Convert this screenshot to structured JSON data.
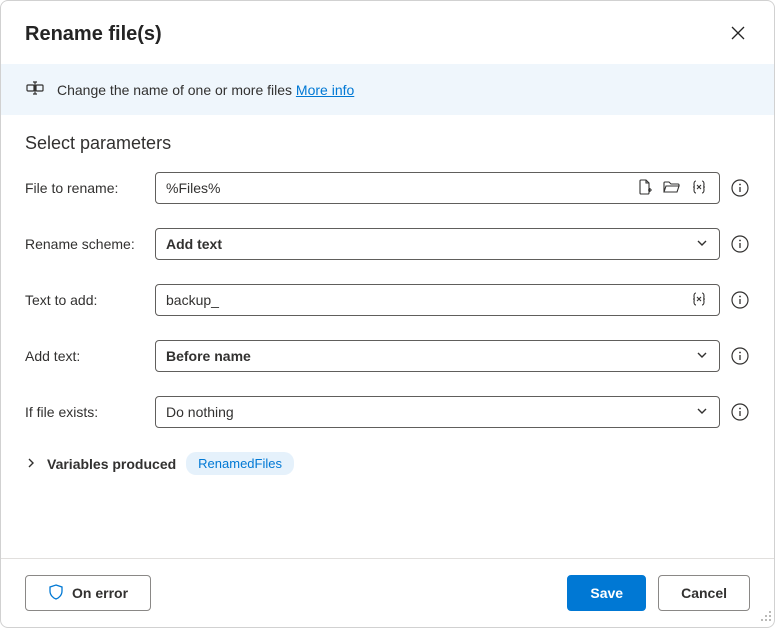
{
  "dialog": {
    "title": "Rename file(s)"
  },
  "banner": {
    "text": "Change the name of one or more files ",
    "more_info": "More info"
  },
  "section": {
    "heading": "Select parameters"
  },
  "fields": {
    "file_to_rename": {
      "label": "File to rename:",
      "value": "%Files%"
    },
    "rename_scheme": {
      "label": "Rename scheme:",
      "value": "Add text"
    },
    "text_to_add": {
      "label": "Text to add:",
      "value": "backup_"
    },
    "add_text": {
      "label": "Add text:",
      "value": "Before name"
    },
    "if_file_exists": {
      "label": "If file exists:",
      "value": "Do nothing"
    }
  },
  "variables": {
    "label": "Variables produced",
    "chip": "RenamedFiles"
  },
  "footer": {
    "on_error": "On error",
    "save": "Save",
    "cancel": "Cancel"
  }
}
